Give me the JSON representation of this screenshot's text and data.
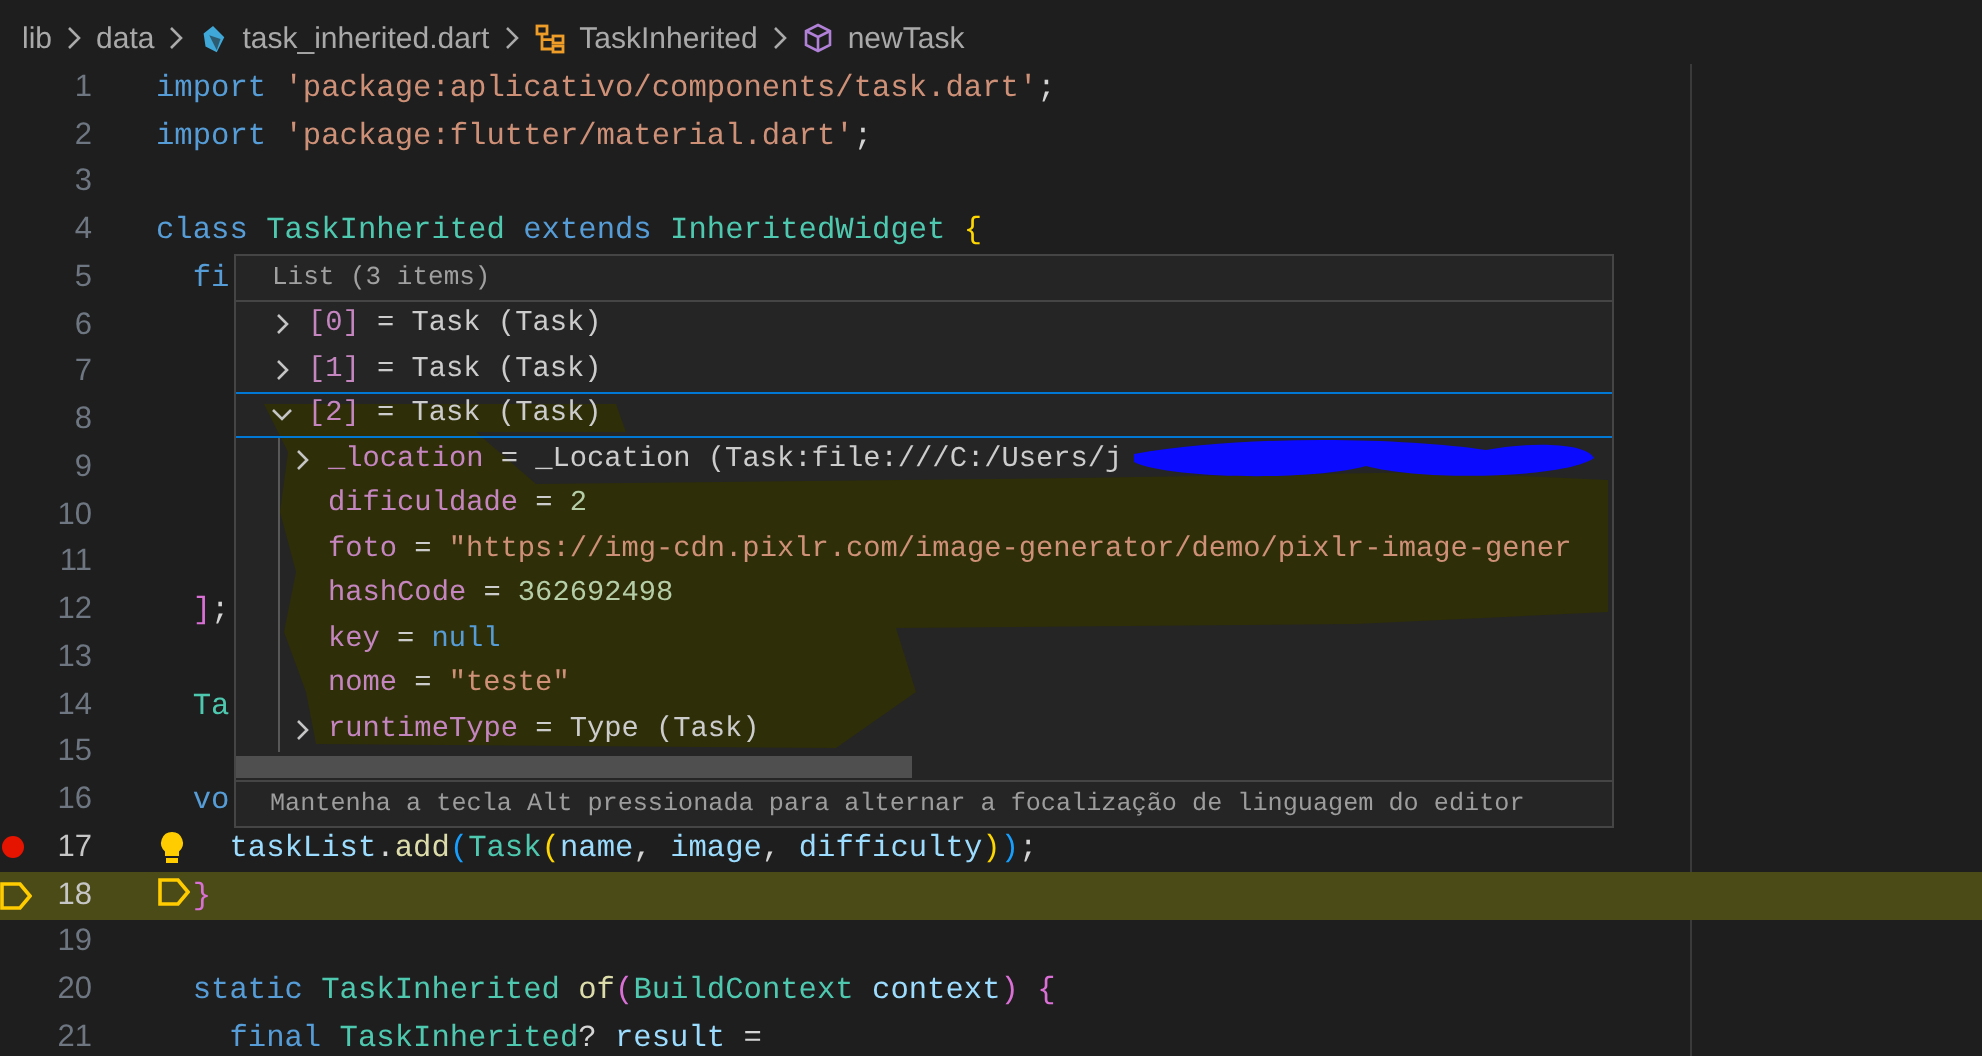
{
  "breadcrumbs": [
    {
      "label": "lib",
      "kind": "folder"
    },
    {
      "label": "data",
      "kind": "folder"
    },
    {
      "label": "task_inherited.dart",
      "kind": "dart-file"
    },
    {
      "label": "TaskInherited",
      "kind": "class"
    },
    {
      "label": "newTask",
      "kind": "method"
    }
  ],
  "editor": {
    "lines": [
      {
        "number": "1",
        "breakpoint": false,
        "current": false,
        "lightbulb": false,
        "tokens": [
          {
            "text": "import",
            "kind": "keyword"
          },
          {
            "text": " 'package:aplicativo/components/task.dart'",
            "kind": "string"
          },
          {
            "text": ";",
            "kind": "plain"
          }
        ]
      },
      {
        "number": "2",
        "breakpoint": false,
        "current": false,
        "lightbulb": false,
        "tokens": [
          {
            "text": "import",
            "kind": "keyword"
          },
          {
            "text": " 'package:flutter/material.dart'",
            "kind": "string"
          },
          {
            "text": ";",
            "kind": "plain"
          }
        ]
      },
      {
        "number": "3",
        "breakpoint": false,
        "current": false,
        "lightbulb": false
      },
      {
        "number": "4",
        "breakpoint": false,
        "current": false,
        "lightbulb": false,
        "tokens": [
          {
            "text": "class",
            "kind": "keyword"
          },
          {
            "text": " TaskInherited",
            "kind": "type"
          },
          {
            "text": " extends",
            "kind": "keyword"
          },
          {
            "text": " InheritedWidget",
            "kind": "type"
          },
          {
            "text": " {",
            "kind": "bracket1"
          }
        ]
      },
      {
        "number": "5",
        "breakpoint": false,
        "current": false,
        "lightbulb": false,
        "tokens": [
          {
            "text": "  fi",
            "kind": "keyword"
          }
        ]
      },
      {
        "number": "6",
        "breakpoint": false,
        "current": false,
        "lightbulb": false
      },
      {
        "number": "7",
        "breakpoint": false,
        "current": false,
        "lightbulb": false
      },
      {
        "number": "8",
        "breakpoint": false,
        "current": false,
        "lightbulb": false
      },
      {
        "number": "9",
        "breakpoint": false,
        "current": false,
        "lightbulb": false
      },
      {
        "number": "10",
        "breakpoint": false,
        "current": false,
        "lightbulb": false
      },
      {
        "number": "11",
        "breakpoint": false,
        "current": false,
        "lightbulb": false
      },
      {
        "number": "12",
        "breakpoint": false,
        "current": false,
        "lightbulb": false,
        "tokens": [
          {
            "text": "  ]",
            "kind": "bracket2"
          },
          {
            "text": ";",
            "kind": "plain"
          }
        ]
      },
      {
        "number": "13",
        "breakpoint": false,
        "current": false,
        "lightbulb": false
      },
      {
        "number": "14",
        "breakpoint": false,
        "current": false,
        "lightbulb": false,
        "tokens": [
          {
            "text": "  Ta",
            "kind": "type"
          }
        ]
      },
      {
        "number": "15",
        "breakpoint": false,
        "current": false,
        "lightbulb": false
      },
      {
        "number": "16",
        "breakpoint": false,
        "current": false,
        "lightbulb": false,
        "tokens": [
          {
            "text": "  vo",
            "kind": "keyword"
          }
        ]
      },
      {
        "number": "17",
        "breakpoint": true,
        "current": false,
        "lightbulb": true,
        "tokens": [
          {
            "text": "    taskList",
            "kind": "variable"
          },
          {
            "text": ".",
            "kind": "plain"
          },
          {
            "text": "add",
            "kind": "function"
          },
          {
            "text": "(",
            "kind": "bracket3"
          },
          {
            "text": "Task",
            "kind": "type"
          },
          {
            "text": "(",
            "kind": "bracket1"
          },
          {
            "text": "name",
            "kind": "variable"
          },
          {
            "text": ",",
            "kind": "plain"
          },
          {
            "text": " image",
            "kind": "variable"
          },
          {
            "text": ",",
            "kind": "plain"
          },
          {
            "text": " difficulty",
            "kind": "variable"
          },
          {
            "text": ")",
            "kind": "bracket1"
          },
          {
            "text": ")",
            "kind": "bracket3"
          },
          {
            "text": ";",
            "kind": "plain"
          }
        ]
      },
      {
        "number": "18",
        "breakpoint": false,
        "current": true,
        "lightbulb": false,
        "tokens": [
          {
            "text": "  }",
            "kind": "bracket2"
          }
        ]
      },
      {
        "number": "19",
        "breakpoint": false,
        "current": false,
        "lightbulb": false
      },
      {
        "number": "20",
        "breakpoint": false,
        "current": false,
        "lightbulb": false,
        "tokens": [
          {
            "text": "  static",
            "kind": "keyword"
          },
          {
            "text": " TaskInherited",
            "kind": "type"
          },
          {
            "text": " of",
            "kind": "function"
          },
          {
            "text": "(",
            "kind": "bracket2"
          },
          {
            "text": "BuildContext",
            "kind": "type"
          },
          {
            "text": " context",
            "kind": "variable"
          },
          {
            "text": ")",
            "kind": "bracket2"
          },
          {
            "text": " {",
            "kind": "bracket2"
          }
        ]
      },
      {
        "number": "21",
        "breakpoint": false,
        "current": false,
        "lightbulb": false,
        "tokens": [
          {
            "text": "    final",
            "kind": "keyword"
          },
          {
            "text": " TaskInherited",
            "kind": "type"
          },
          {
            "text": "?",
            "kind": "plain"
          },
          {
            "text": " result",
            "kind": "variable"
          },
          {
            "text": " =",
            "kind": "plain"
          }
        ]
      }
    ]
  },
  "hover": {
    "header": "List (3 items)",
    "items": [
      {
        "name": "[0]",
        "operator": "=",
        "value": "Task (Task)",
        "kind": "object",
        "expandable": true,
        "expanded": false,
        "selected": false
      },
      {
        "name": "[1]",
        "operator": "=",
        "value": "Task (Task)",
        "kind": "object",
        "expandable": true,
        "expanded": false,
        "selected": false
      },
      {
        "name": "[2]",
        "operator": "=",
        "value": "Task (Task)",
        "kind": "object",
        "expandable": true,
        "expanded": true,
        "selected": true,
        "children": [
          {
            "name": "_location",
            "operator": "=",
            "value": "_Location (Task:file:///C:/Users/j",
            "kind": "object",
            "expandable": true,
            "expanded": false,
            "selected": false,
            "redacted": true
          },
          {
            "name": "dificuldade",
            "operator": "=",
            "value": "2",
            "kind": "number",
            "expandable": false,
            "expanded": false,
            "selected": false,
            "redacted": false
          },
          {
            "name": "foto",
            "operator": "=",
            "value": "\"https://img-cdn.pixlr.com/image-generator/demo/pixlr-image-gener",
            "kind": "string",
            "expandable": false,
            "expanded": false,
            "selected": false,
            "redacted": false
          },
          {
            "name": "hashCode",
            "operator": "=",
            "value": "362692498",
            "kind": "number",
            "expandable": false,
            "expanded": false,
            "selected": false,
            "redacted": false
          },
          {
            "name": "key",
            "operator": "=",
            "value": "null",
            "kind": "null",
            "expandable": false,
            "expanded": false,
            "selected": false,
            "redacted": false
          },
          {
            "name": "nome",
            "operator": "=",
            "value": "\"teste\"",
            "kind": "string",
            "expandable": false,
            "expanded": false,
            "selected": false,
            "redacted": false
          },
          {
            "name": "runtimeType",
            "operator": "=",
            "value": "Type (Task)",
            "kind": "object",
            "expandable": true,
            "expanded": false,
            "selected": false,
            "redacted": false
          }
        ]
      }
    ],
    "footer": "Mantenha a tecla Alt pressionada para alternar a focalização de linguagem do editor"
  }
}
